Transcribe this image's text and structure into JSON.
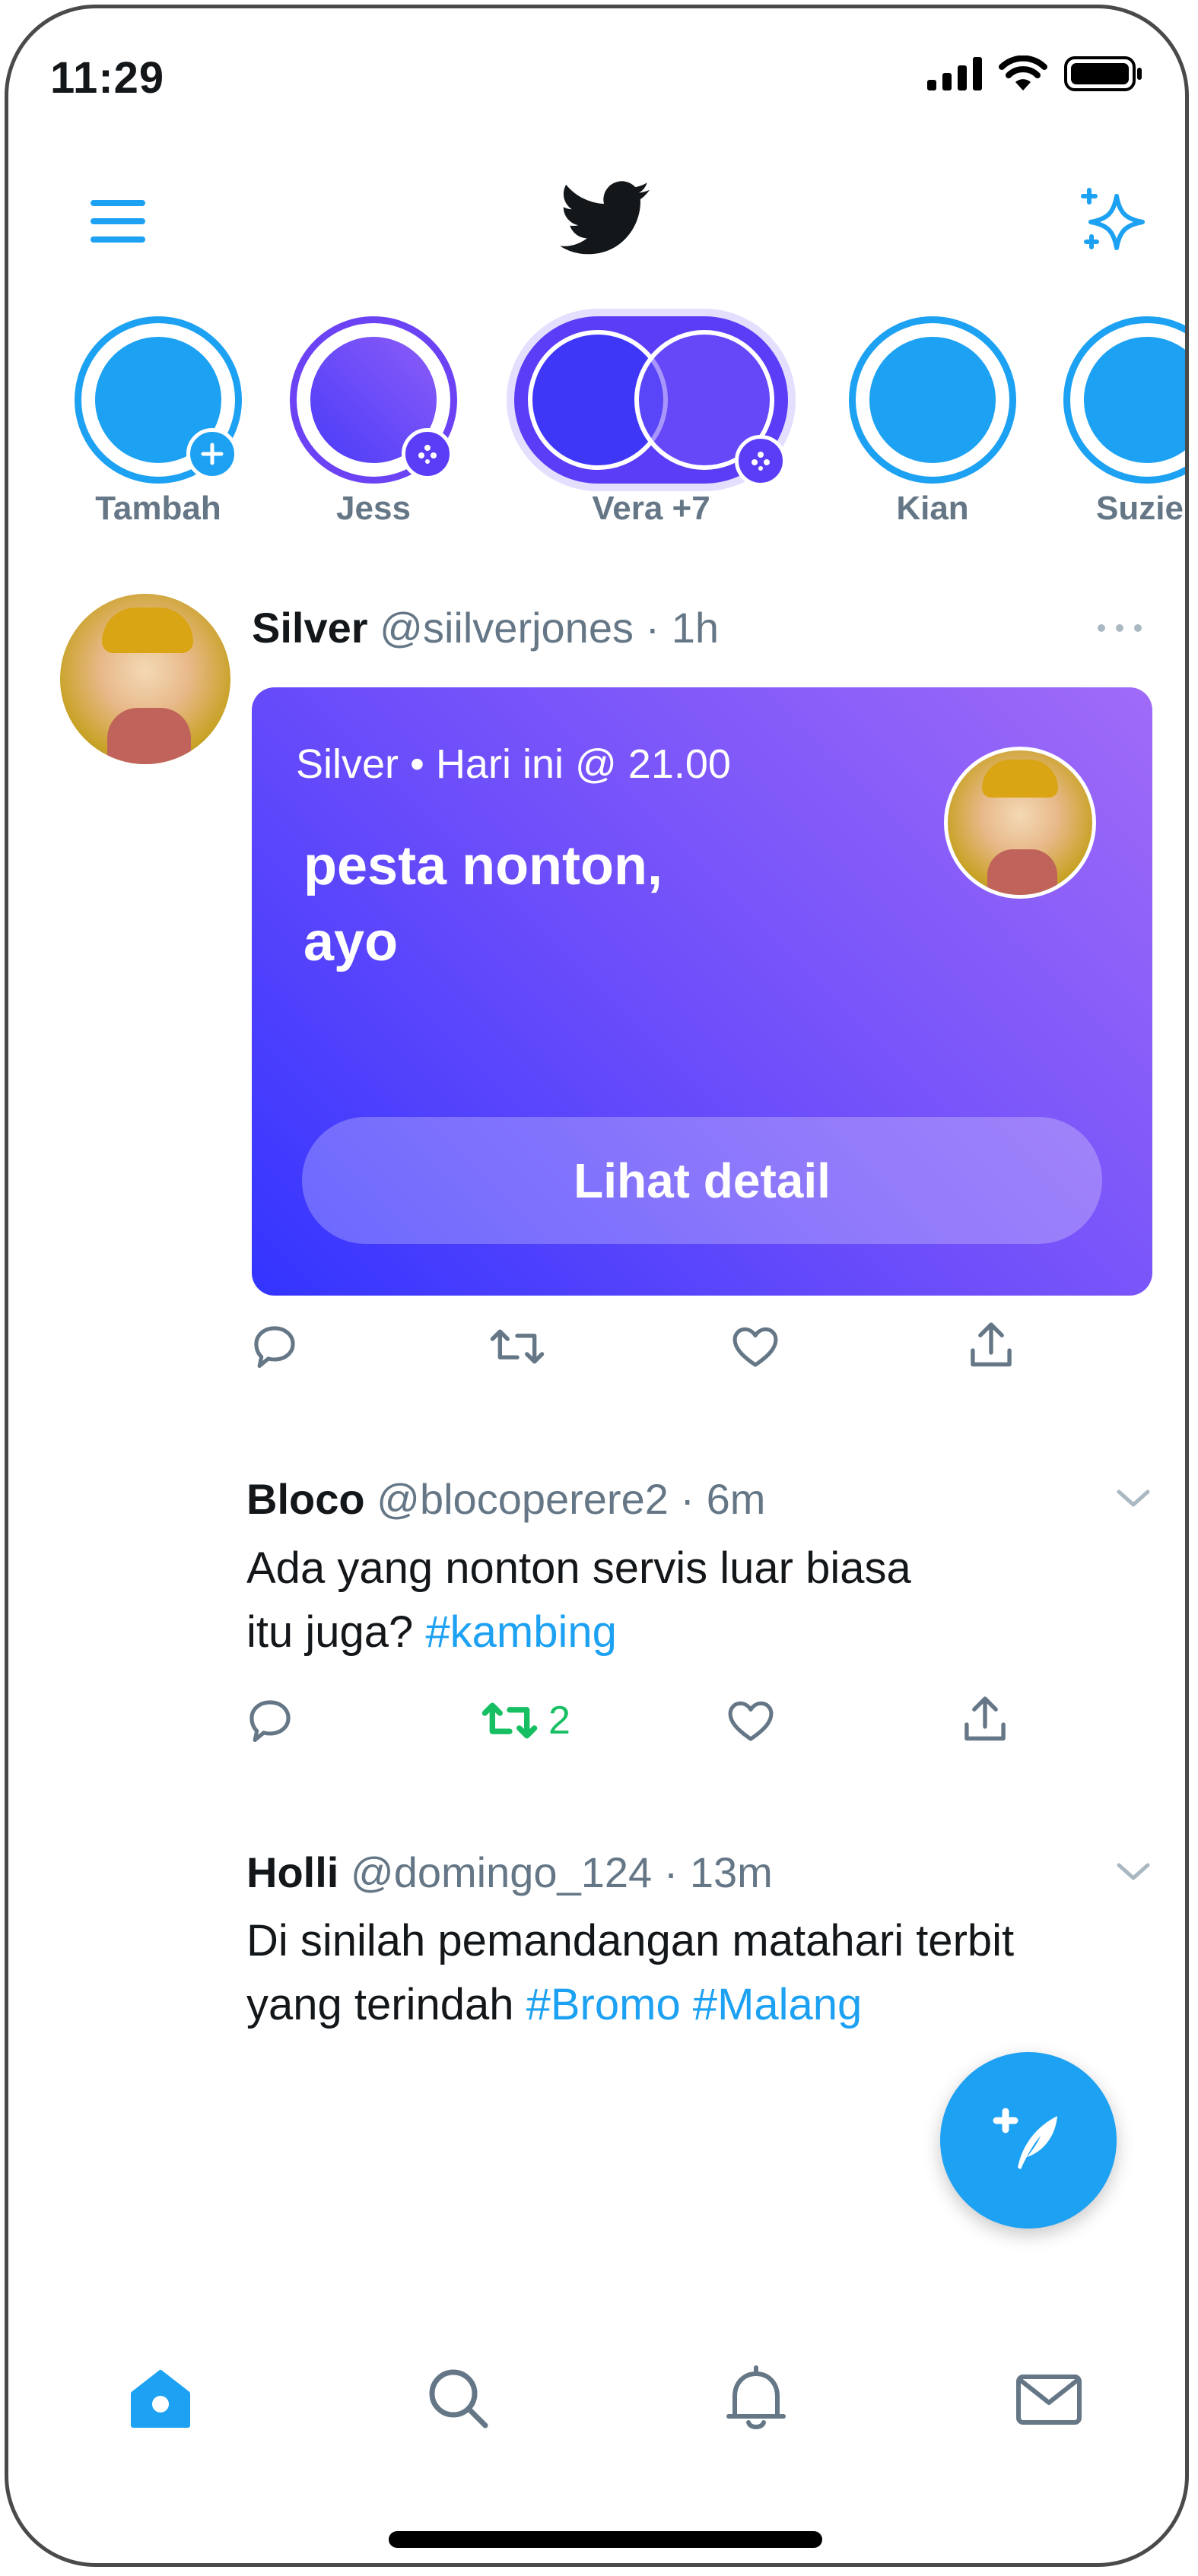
{
  "status_bar": {
    "time": "11:29"
  },
  "stories": [
    {
      "label": "Tambah",
      "ring": "#1da1f2",
      "fill": "#1da1f2",
      "badge": "plus"
    },
    {
      "label": "Jess",
      "ring": "#6b43f5",
      "fill": "#6b4dfa",
      "badge": "dots"
    },
    {
      "label": "Vera +7",
      "ring": "#5b3df7",
      "fill": "#4c3cf9",
      "badge": "dots"
    },
    {
      "label": "Kian",
      "ring": "#1da1f2",
      "fill": "#1da1f2",
      "badge": ""
    },
    {
      "label": "Suzie",
      "ring": "#1da1f2",
      "fill": "#1da1f2",
      "badge": ""
    }
  ],
  "tweets": [
    {
      "name": "Silver",
      "handle": "@siilverjones",
      "time": "· 1h",
      "card": {
        "meta": "Silver • Hari ini @ 21.00",
        "title_line1": "pesta nonton,",
        "title_line2": "ayo",
        "button": "Lihat detail"
      }
    },
    {
      "name": "Bloco",
      "handle": "@blocoperere2 · 6m",
      "text_line1": "Ada yang nonton servis luar biasa",
      "text_line2": "itu juga? ",
      "hashtag": "#kambing",
      "retweet_count": "2"
    },
    {
      "name": "Holli",
      "handle": "@domingo_124 · 13m",
      "text_line1": "Di sinilah pemandangan matahari terbit",
      "text_line2": "yang terindah ",
      "hashtags": "#Bromo #Malang"
    }
  ],
  "colors": {
    "accent": "#1da1f2",
    "retweet_active": "#17bf63",
    "icon_gray": "#657786"
  }
}
